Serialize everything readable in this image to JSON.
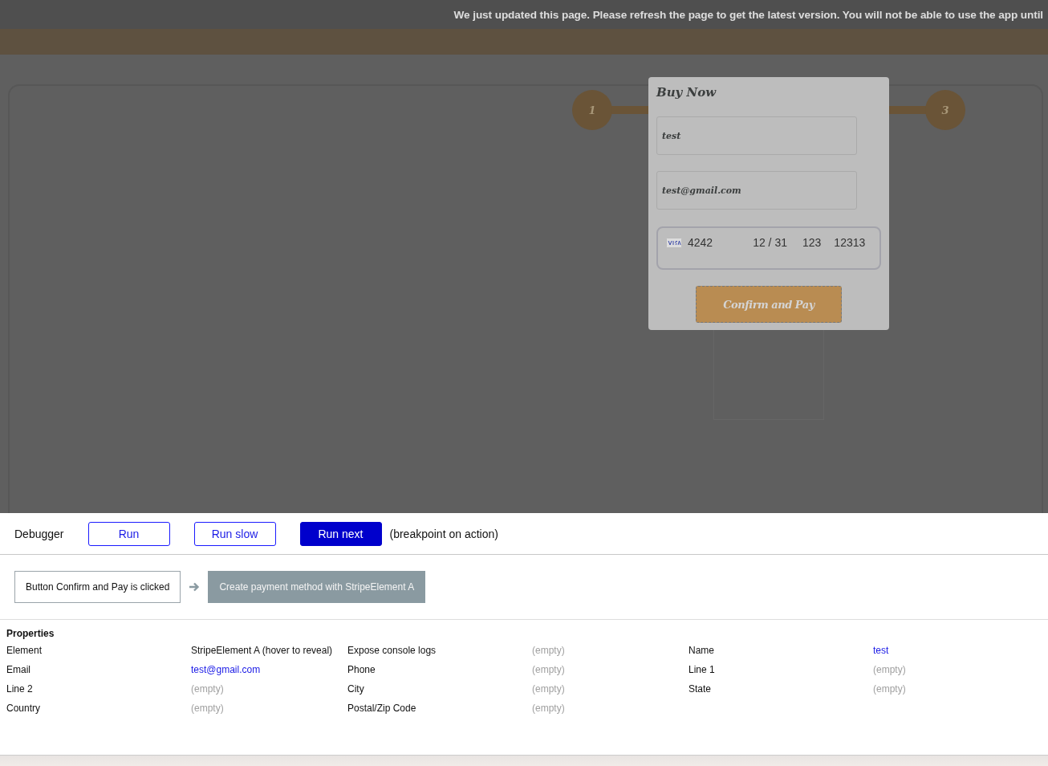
{
  "banner": {
    "text": "We just updated this page. Please refresh the page to get the latest version. You will not be able to use the app until"
  },
  "stepper": {
    "steps": [
      {
        "label": "1"
      },
      {
        "label": "3"
      }
    ]
  },
  "modal": {
    "title": "Buy Now",
    "fields": [
      {
        "value": "test"
      },
      {
        "value": "test@gmail.com"
      }
    ],
    "card": {
      "number": "4242",
      "expiry": "12 / 31",
      "cvc": "123",
      "zip": "12313"
    },
    "button": "Confirm and Pay"
  },
  "debugger": {
    "title": "Debugger",
    "buttons": [
      {
        "label": "Run",
        "selected": false
      },
      {
        "label": "Run slow",
        "selected": false
      },
      {
        "label": "Run next",
        "selected": true
      }
    ],
    "note": "(breakpoint on action)",
    "steps": [
      {
        "text": "Button Confirm and Pay is clicked",
        "kind": "event"
      },
      {
        "text": "Create payment method with StripeElement A",
        "kind": "action"
      }
    ]
  },
  "properties": {
    "title": "Properties",
    "rows": [
      [
        {
          "label": "Element",
          "value": "StripeElement A (hover to reveal)",
          "kind": "plain"
        },
        {
          "label": "Expose console logs",
          "value": "(empty)",
          "kind": "empty"
        },
        {
          "label": "Name",
          "value": "test",
          "kind": "link"
        }
      ],
      [
        {
          "label": "Email",
          "value": "test@gmail.com",
          "kind": "link"
        },
        {
          "label": "Phone",
          "value": "(empty)",
          "kind": "empty"
        },
        {
          "label": "Line 1",
          "value": "(empty)",
          "kind": "empty"
        }
      ],
      [
        {
          "label": "Line 2",
          "value": "(empty)",
          "kind": "empty"
        },
        {
          "label": "City",
          "value": "(empty)",
          "kind": "empty"
        },
        {
          "label": "State",
          "value": "(empty)",
          "kind": "empty"
        }
      ],
      [
        {
          "label": "Country",
          "value": "(empty)",
          "kind": "empty"
        },
        {
          "label": "Postal/Zip Code",
          "value": "(empty)",
          "kind": "empty"
        }
      ]
    ]
  }
}
